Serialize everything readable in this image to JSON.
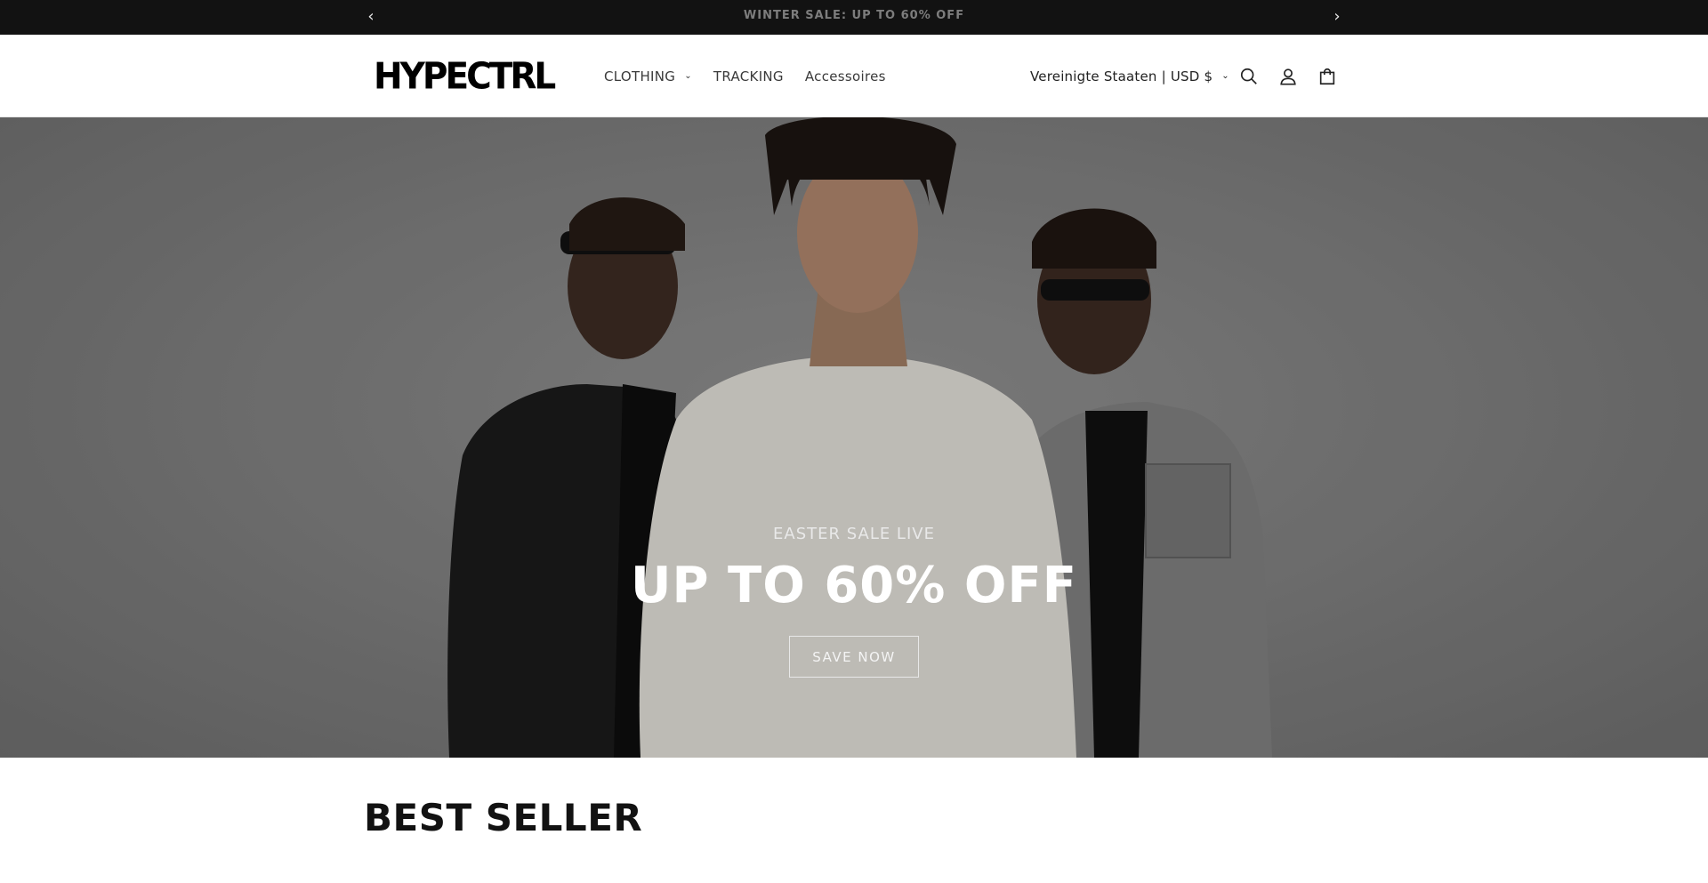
{
  "announcement": {
    "message": "WINTER SALE: UP TO 60% OFF",
    "prev_arrow": "‹",
    "next_arrow": "›"
  },
  "header": {
    "logo": "HYPECTRL",
    "nav": [
      {
        "label": "CLOTHING",
        "has_dropdown": true
      },
      {
        "label": "TRACKING",
        "has_dropdown": false
      },
      {
        "label": "Accessoires",
        "has_dropdown": false
      }
    ],
    "region": "Vereinigte Staaten | USD $",
    "icons": [
      "search-icon",
      "account-icon",
      "cart-icon"
    ]
  },
  "hero": {
    "subtitle": "EASTER SALE LIVE",
    "title": "UP TO 60% OFF",
    "button": "SAVE NOW"
  },
  "best_seller": {
    "title": "BEST SELLER"
  },
  "colors": {
    "announcement_bg": "#121212",
    "announcement_text": "#7d7d7d",
    "hero_bg": "#7c7c7c",
    "text": "#121212"
  }
}
